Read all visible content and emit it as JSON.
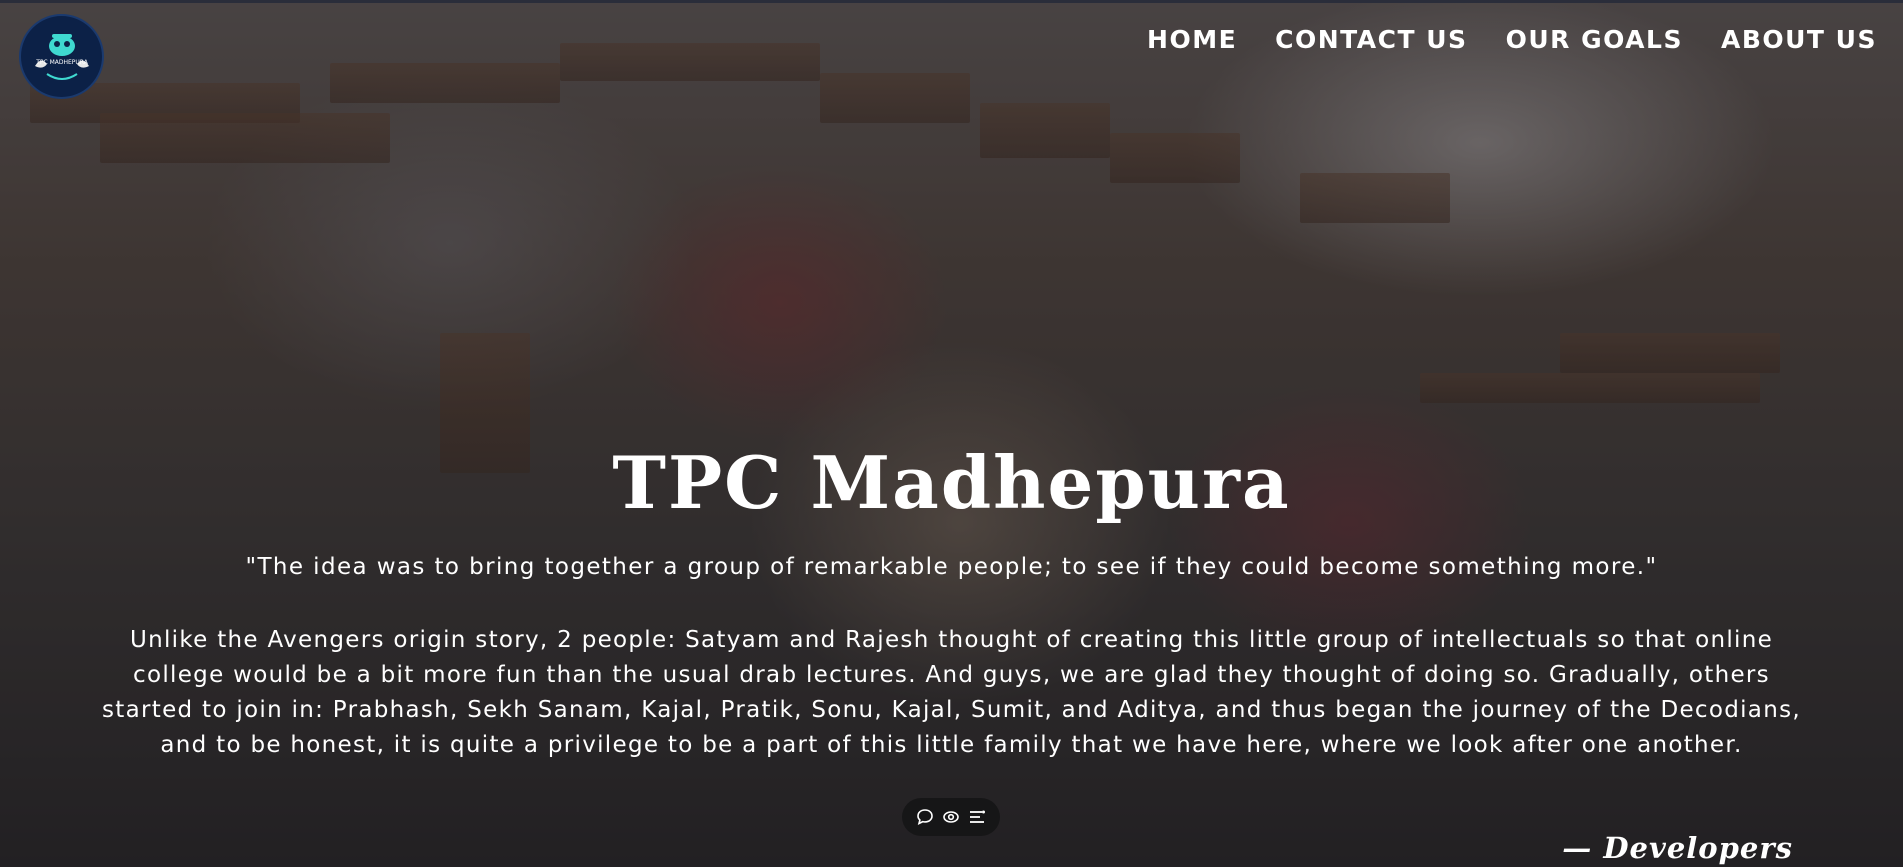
{
  "brand": {
    "logo_text": "TPC MADHEPURA"
  },
  "nav": {
    "items": [
      {
        "label": "HOME"
      },
      {
        "label": "CONTACT US"
      },
      {
        "label": "OUR GOALS"
      },
      {
        "label": "ABOUT US"
      }
    ]
  },
  "hero": {
    "title": "TPC Madhepura",
    "quote": "\"The idea was to bring together a group of remarkable people; to see if they could become something more.\"",
    "body": "Unlike the Avengers origin story, 2 people: Satyam and Rajesh thought of creating this little group of intellectuals so that online college would be a bit more fun than the usual drab lectures. And guys, we are glad they thought of doing so. Gradually, others started to join in: Prabhash, Sekh Sanam, Kajal, Pratik, Sonu, Kajal, Sumit, and Aditya, and thus began the journey of the Decodians, and to be honest, it is quite a privilege to be a part of this little family that we have here, where we look after one another.",
    "signature": "— Developers"
  },
  "toolbar": {
    "icons": [
      "chat-icon",
      "eye-icon",
      "list-icon"
    ]
  },
  "colors": {
    "text": "#ffffff",
    "logo_bg": "#0c2147",
    "logo_accent": "#3fd9d0"
  }
}
